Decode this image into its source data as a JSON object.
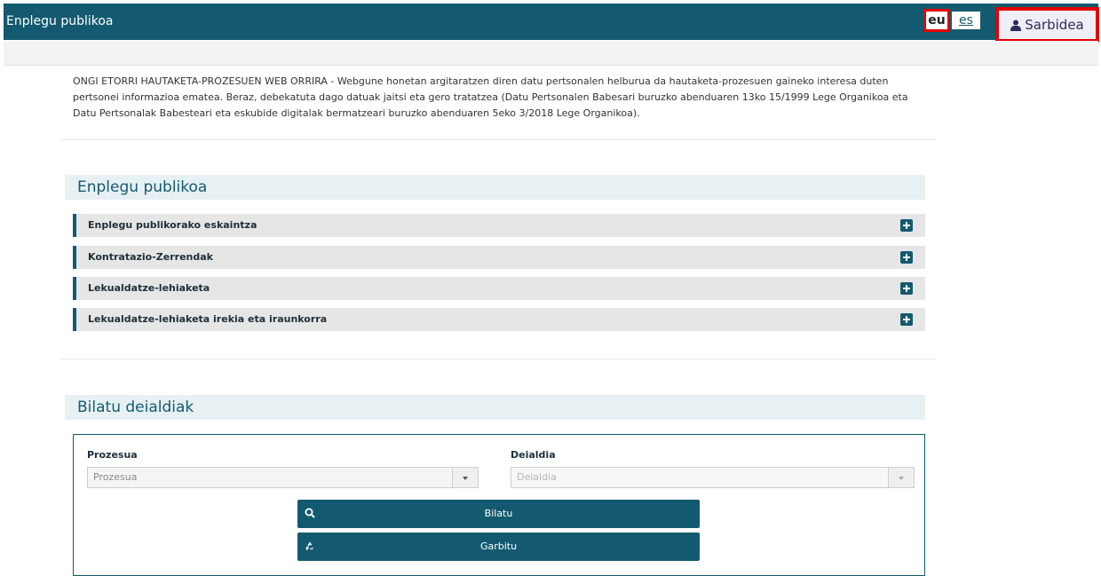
{
  "header": {
    "title": "Enplegu publikoa",
    "lang_eu": "eu",
    "lang_es": "es",
    "login_label": "Sarbidea"
  },
  "intro": {
    "text": "ONGI ETORRI HAUTAKETA-PROZESUEN WEB ORRIRA - Webgune honetan argitaratzen diren datu pertsonalen helburua da hautaketa-prozesuen gaineko interesa duten pertsonei informazioa ematea. Beraz, debekatuta dago datuak jaitsi eta gero tratatzea (Datu Pertsonalen Babesari buruzko abenduaren 13ko 15/1999 Lege Organikoa eta Datu Pertsonalak Babesteari eta eskubide digitalak bermatzeari buruzko abenduaren 5eko 3/2018 Lege Organikoa)."
  },
  "public_employment": {
    "heading": "Enplegu publikoa",
    "items": [
      {
        "label": "Enplegu publikorako eskaintza"
      },
      {
        "label": "Kontratazio-Zerrendak"
      },
      {
        "label": "Lekualdatze-lehiaketa"
      },
      {
        "label": "Lekualdatze-lehiaketa irekia eta iraunkorra"
      }
    ]
  },
  "search": {
    "heading": "Bilatu deialdiak",
    "process_label": "Prozesua",
    "process_placeholder": "Prozesua",
    "call_label": "Deialdia",
    "call_placeholder": "Deialdia",
    "search_button": "Bilatu",
    "clear_button": "Garbitu"
  },
  "colors": {
    "primary": "#135a70",
    "highlight": "#e60000"
  },
  "icons": {
    "login": "user-icon",
    "accordion_toggle": "plus-icon",
    "search": "search-icon",
    "clear": "recycle-icon"
  }
}
